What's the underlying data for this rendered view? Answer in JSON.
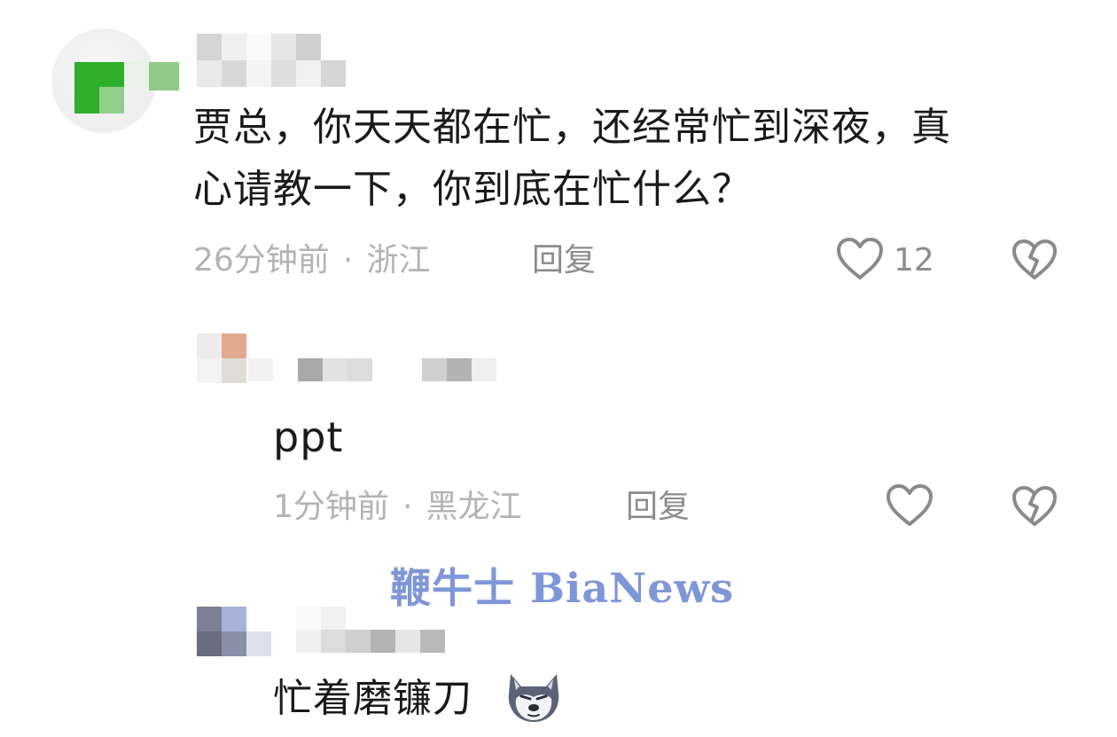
{
  "comments": [
    {
      "text_line1": "贾总，你天天都在忙，还经常忙到深夜，真",
      "text_line2": "心请教一下，你到底在忙什么？",
      "time": "26分钟前",
      "separator": "·",
      "location": "浙江",
      "reply_label": "回复",
      "like_count": "12"
    },
    {
      "text": "ppt",
      "time": "1分钟前",
      "separator": "·",
      "location": "黑龙江",
      "reply_label": "回复"
    },
    {
      "text": "忙着磨镰刀"
    }
  ],
  "watermark": "鞭牛士 BiaNews",
  "icons": {
    "like": "heart-outline-icon",
    "dislike": "broken-heart-icon",
    "emoji": "husky-dog-emoji"
  },
  "colors": {
    "text": "#1a1a1a",
    "meta": "#b3b3b3",
    "reply": "#8c8c8c",
    "watermark": "#7f96d8",
    "icon": "#8a8a8a"
  }
}
